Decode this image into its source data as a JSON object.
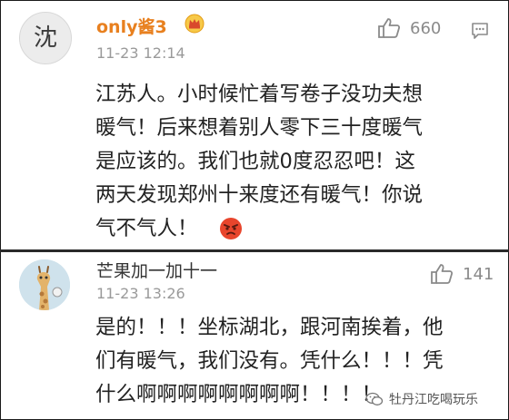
{
  "comments": [
    {
      "username": "only酱3",
      "timestamp": "11-23 12:14",
      "likes": "660",
      "avatar_char": "沈",
      "lines": [
        "江苏人。小时候忙着写卷子没功夫想",
        "暖气！后来想着别人零下三十度暖气",
        "是应该的。我们也就0度忍忍吧！这",
        "两天发现郑州十来度还有暖气！你说",
        "气不气人！"
      ]
    },
    {
      "username": "芒果加一加十一",
      "timestamp": "11-23 13:26",
      "likes": "141",
      "lines": [
        "是的！！！坐标湖北，跟河南挨着，他",
        "们有暖气，我们没有。凭什么！！！凭",
        "什么啊啊啊啊啊啊啊啊！！！！"
      ]
    }
  ],
  "watermark": "牡丹江吃喝玩乐",
  "colors": {
    "vip_name": "#e8801f",
    "text": "#222222",
    "meta": "#9a9a9a"
  }
}
